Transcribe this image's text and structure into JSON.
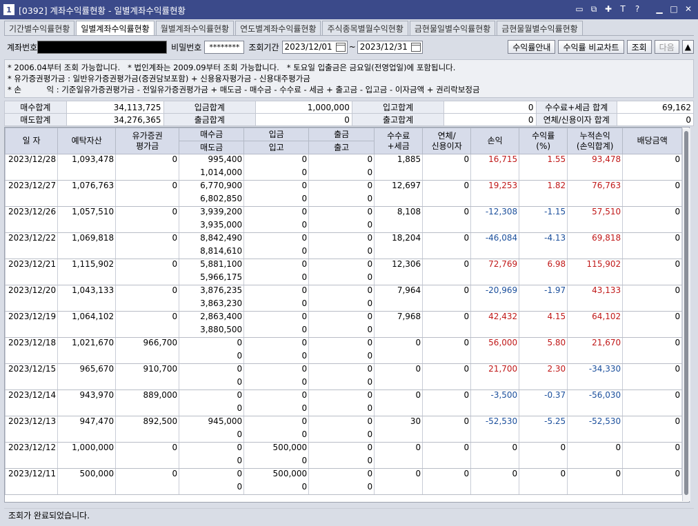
{
  "window": {
    "number": "1",
    "title": "[0392] 계좌수익률현황 - 일별계좌수익률현황",
    "controls": [
      "▭",
      "⧉",
      "✚",
      "T",
      "?",
      "▁",
      "□",
      "✕"
    ]
  },
  "tabs": [
    {
      "label": "기간별수익률현황",
      "active": false
    },
    {
      "label": "일별계좌수익률현황",
      "active": true
    },
    {
      "label": "월별계좌수익률현황",
      "active": false
    },
    {
      "label": "연도별계좌수익률현황",
      "active": false
    },
    {
      "label": "주식종목별월수익현황",
      "active": false
    },
    {
      "label": "금현물일별수익률현황",
      "active": false
    },
    {
      "label": "금현물월별수익률현황",
      "active": false
    }
  ],
  "query": {
    "account_label": "계좌번호",
    "password_label": "비밀번호",
    "password_value": "********",
    "period_label": "조회기간",
    "date_from": "2023/12/01",
    "tilde": "~",
    "date_to": "2023/12/31",
    "btn_guide": "수익률안내",
    "btn_compare": "수익률 비교차트",
    "btn_search": "조회",
    "btn_next": "다음",
    "btn_up": "▲"
  },
  "notes": [
    "* 2006.04부터 조회 가능합니다.   * 법인계좌는 2009.09부터 조회 가능합니다.   * 토요일 입출금은 금요일(전영업일)에 포함됩니다.",
    "* 유가증권평가금 : 일반유가증권평가금(증권담보포함) + 신용융자평가금 - 신용대주평가금",
    "* 손          익 : 기준일유가증권평가금 - 전일유가증권평가금 + 매도금 - 매수금 - 수수료 - 세금 + 출고금 - 입고금 - 이자금액 + 권리락보정금"
  ],
  "summary": {
    "buy_total_label": "매수합계",
    "buy_total": "34,113,725",
    "deposit_total_label": "입금합계",
    "deposit_total": "1,000,000",
    "in_total_label": "입고합계",
    "in_total": "0",
    "fee_tax_label": "수수료+세금 합계",
    "fee_tax": "69,162",
    "sell_total_label": "매도합계",
    "sell_total": "34,276,365",
    "withdraw_total_label": "출금합계",
    "withdraw_total": "0",
    "out_total_label": "출고합계",
    "out_total": "0",
    "overdue_label": "연체/신용이자 합계",
    "overdue": "0"
  },
  "grid": {
    "headers": {
      "date": "일 자",
      "deposit_assets": "예탁자산",
      "securities_1": "유가증권",
      "securities_2": "평가금",
      "buy": "매수금",
      "sell": "매도금",
      "deposit": "입금",
      "in": "입고",
      "withdraw": "출금",
      "out": "출고",
      "fee_1": "수수료",
      "fee_2": "+세금",
      "overdue_1": "연체/",
      "overdue_2": "신용이자",
      "pnl": "손익",
      "rate_1": "수익률",
      "rate_2": "(%)",
      "cum_1": "누적손익",
      "cum_2": "(손익합계)",
      "dividend": "배당금액"
    },
    "rows": [
      {
        "date": "2023/12/28",
        "assets": "1,093,478",
        "sec": "0",
        "buy": "995,400",
        "sell": "1,014,000",
        "deposit": "0",
        "in": "0",
        "withdraw": "0",
        "out": "0",
        "fee": "1,885",
        "overdue": "0",
        "pnl": "16,715",
        "rate": "1.55",
        "cum": "93,478",
        "div": "0",
        "pnl_sign": "pos",
        "cum_sign": "pos"
      },
      {
        "date": "2023/12/27",
        "assets": "1,076,763",
        "sec": "0",
        "buy": "6,770,900",
        "sell": "6,802,850",
        "deposit": "0",
        "in": "0",
        "withdraw": "0",
        "out": "0",
        "fee": "12,697",
        "overdue": "0",
        "pnl": "19,253",
        "rate": "1.82",
        "cum": "76,763",
        "div": "0",
        "pnl_sign": "pos",
        "cum_sign": "pos"
      },
      {
        "date": "2023/12/26",
        "assets": "1,057,510",
        "sec": "0",
        "buy": "3,939,200",
        "sell": "3,935,000",
        "deposit": "0",
        "in": "0",
        "withdraw": "0",
        "out": "0",
        "fee": "8,108",
        "overdue": "0",
        "pnl": "-12,308",
        "rate": "-1.15",
        "cum": "57,510",
        "div": "0",
        "pnl_sign": "neg",
        "cum_sign": "pos"
      },
      {
        "date": "2023/12/22",
        "assets": "1,069,818",
        "sec": "0",
        "buy": "8,842,490",
        "sell": "8,814,610",
        "deposit": "0",
        "in": "0",
        "withdraw": "0",
        "out": "0",
        "fee": "18,204",
        "overdue": "0",
        "pnl": "-46,084",
        "rate": "-4.13",
        "cum": "69,818",
        "div": "0",
        "pnl_sign": "neg",
        "cum_sign": "pos"
      },
      {
        "date": "2023/12/21",
        "assets": "1,115,902",
        "sec": "0",
        "buy": "5,881,100",
        "sell": "5,966,175",
        "deposit": "0",
        "in": "0",
        "withdraw": "0",
        "out": "0",
        "fee": "12,306",
        "overdue": "0",
        "pnl": "72,769",
        "rate": "6.98",
        "cum": "115,902",
        "div": "0",
        "pnl_sign": "pos",
        "cum_sign": "pos"
      },
      {
        "date": "2023/12/20",
        "assets": "1,043,133",
        "sec": "0",
        "buy": "3,876,235",
        "sell": "3,863,230",
        "deposit": "0",
        "in": "0",
        "withdraw": "0",
        "out": "0",
        "fee": "7,964",
        "overdue": "0",
        "pnl": "-20,969",
        "rate": "-1.97",
        "cum": "43,133",
        "div": "0",
        "pnl_sign": "neg",
        "cum_sign": "pos"
      },
      {
        "date": "2023/12/19",
        "assets": "1,064,102",
        "sec": "0",
        "buy": "2,863,400",
        "sell": "3,880,500",
        "deposit": "0",
        "in": "0",
        "withdraw": "0",
        "out": "0",
        "fee": "7,968",
        "overdue": "0",
        "pnl": "42,432",
        "rate": "4.15",
        "cum": "64,102",
        "div": "0",
        "pnl_sign": "pos",
        "cum_sign": "pos"
      },
      {
        "date": "2023/12/18",
        "assets": "1,021,670",
        "sec": "966,700",
        "buy": "0",
        "sell": "0",
        "deposit": "0",
        "in": "0",
        "withdraw": "0",
        "out": "0",
        "fee": "0",
        "overdue": "0",
        "pnl": "56,000",
        "rate": "5.80",
        "cum": "21,670",
        "div": "0",
        "pnl_sign": "pos",
        "cum_sign": "pos"
      },
      {
        "date": "2023/12/15",
        "assets": "965,670",
        "sec": "910,700",
        "buy": "0",
        "sell": "0",
        "deposit": "0",
        "in": "0",
        "withdraw": "0",
        "out": "0",
        "fee": "0",
        "overdue": "0",
        "pnl": "21,700",
        "rate": "2.30",
        "cum": "-34,330",
        "div": "0",
        "pnl_sign": "pos",
        "cum_sign": "neg"
      },
      {
        "date": "2023/12/14",
        "assets": "943,970",
        "sec": "889,000",
        "buy": "0",
        "sell": "0",
        "deposit": "0",
        "in": "0",
        "withdraw": "0",
        "out": "0",
        "fee": "0",
        "overdue": "0",
        "pnl": "-3,500",
        "rate": "-0.37",
        "cum": "-56,030",
        "div": "0",
        "pnl_sign": "neg",
        "cum_sign": "neg"
      },
      {
        "date": "2023/12/13",
        "assets": "947,470",
        "sec": "892,500",
        "buy": "945,000",
        "sell": "0",
        "deposit": "0",
        "in": "0",
        "withdraw": "0",
        "out": "0",
        "fee": "30",
        "overdue": "0",
        "pnl": "-52,530",
        "rate": "-5.25",
        "cum": "-52,530",
        "div": "0",
        "pnl_sign": "neg",
        "cum_sign": "neg"
      },
      {
        "date": "2023/12/12",
        "assets": "1,000,000",
        "sec": "0",
        "buy": "0",
        "sell": "0",
        "deposit": "500,000",
        "in": "0",
        "withdraw": "0",
        "out": "0",
        "fee": "0",
        "overdue": "0",
        "pnl": "0",
        "rate": "0",
        "cum": "0",
        "div": "0",
        "pnl_sign": "",
        "cum_sign": ""
      },
      {
        "date": "2023/12/11",
        "assets": "500,000",
        "sec": "0",
        "buy": "0",
        "sell": "0",
        "deposit": "500,000",
        "in": "0",
        "withdraw": "0",
        "out": "0",
        "fee": "0",
        "overdue": "0",
        "pnl": "0",
        "rate": "0",
        "cum": "0",
        "div": "0",
        "pnl_sign": "",
        "cum_sign": ""
      }
    ]
  },
  "status": "조회가 완료되었습니다."
}
